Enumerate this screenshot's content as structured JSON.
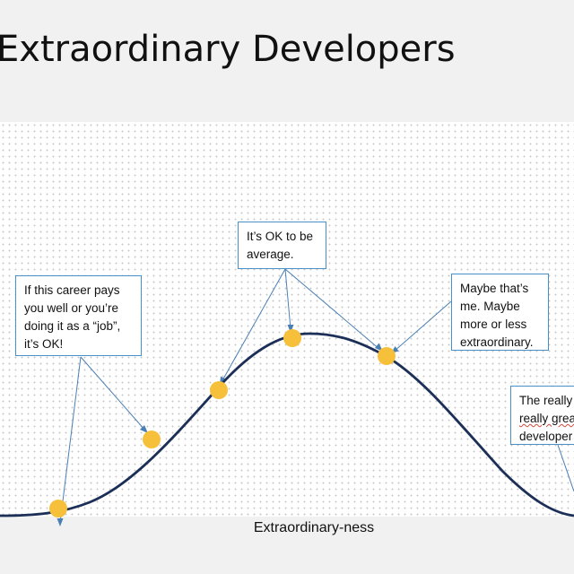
{
  "slide": {
    "title": "Extraordinary Developers"
  },
  "chart": {
    "type": "bell-curve",
    "xlabel": "Extraordinary-ness",
    "curve_color": "#1b2f57",
    "point_color": "#f6c03b",
    "callout_border_color": "#4a90c8",
    "grid": "dotted"
  },
  "callouts": {
    "job": "If this career pays\nyou well or you’re\ndoing it as a “job”,\nit’s OK!",
    "average": "It’s OK to be\naverage.",
    "me": "Maybe that’s\nme. Maybe\nmore or less\nextraordinary.",
    "great_line1": "The really",
    "great_line2": "really grea",
    "great_line3": "developer"
  }
}
